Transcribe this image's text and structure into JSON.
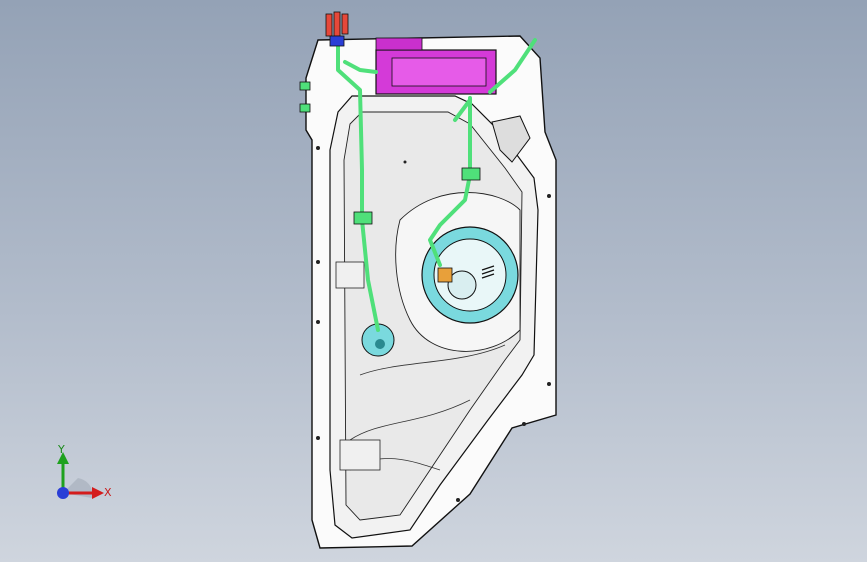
{
  "app": {
    "view": "isometric-3d-cad-viewport"
  },
  "model": {
    "name": "",
    "colors": {
      "hose": "#4fe07a",
      "canister": "#d43ad8",
      "pump_flange": "#3ec7cf",
      "connector": "#e8a03a",
      "outline": "#1a1a1a",
      "sheet": "#ffffff"
    }
  },
  "triad": {
    "x_label": "X",
    "y_label": "Y",
    "x_color": "#d41c1c",
    "y_color": "#1ea11e",
    "z_color": "#2a3ed6"
  },
  "background": {
    "top": "#94a2b6",
    "bottom": "#cfd5de"
  }
}
